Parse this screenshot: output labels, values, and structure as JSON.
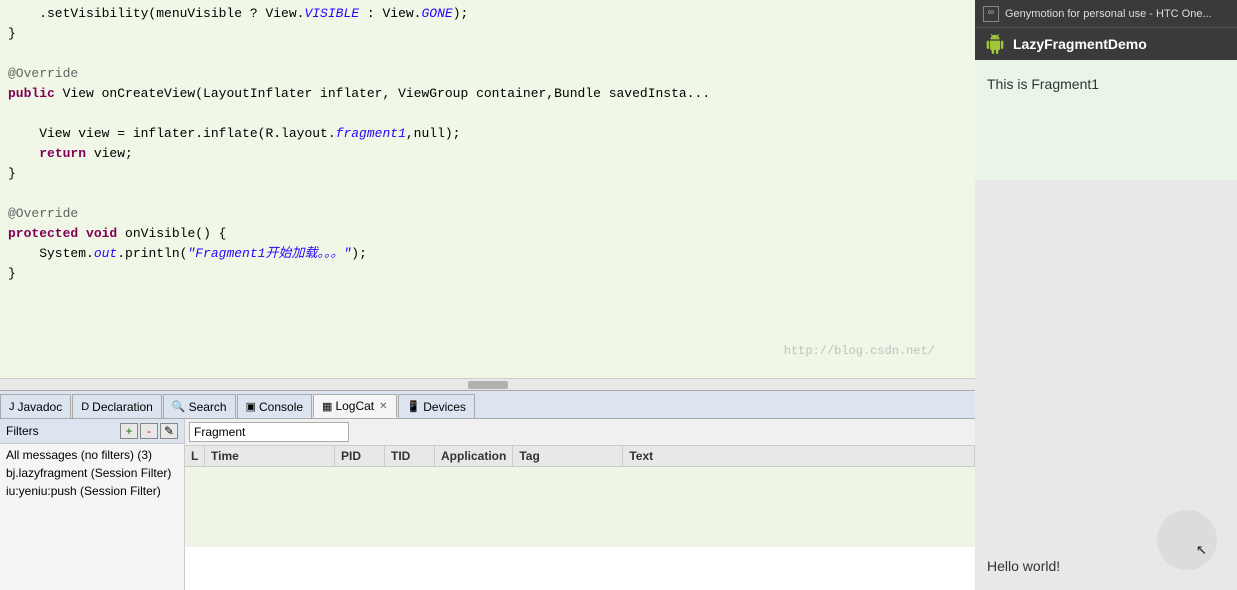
{
  "editor": {
    "code_lines": [
      {
        "content": "    .setVisibility(menuVisible ? View.",
        "italic": "VISIBLE",
        "rest": " : View.",
        "italic2": "GONE",
        "end": ");"
      },
      {
        "content": "}"
      },
      {
        "content": ""
      },
      {
        "content": "@Override",
        "type": "annotation"
      },
      {
        "content": "public View onCreateView(LayoutInflater inflater, ViewGroup container,Bundle savedInsta..."
      },
      {
        "content": ""
      },
      {
        "content": "    View view = inflater.inflate(R.layout.",
        "italic": "fragment1",
        "end": ",null);"
      },
      {
        "content": "    ",
        "kw": "return",
        "rest": " view;"
      },
      {
        "content": "}"
      },
      {
        "content": ""
      },
      {
        "content": "@Override",
        "type": "annotation"
      },
      {
        "content": "protected void onVisible() {"
      },
      {
        "content": "    System.",
        "italic_blue": "out",
        "rest": ".println(\"",
        "string": "Fragment1开始加载。。。",
        "end": "\");"
      },
      {
        "content": "}"
      }
    ],
    "watermark": "http://blog.csdn.net/"
  },
  "tabs": [
    {
      "id": "javadoc",
      "label": "Javadoc",
      "icon": "J",
      "active": false,
      "closable": false
    },
    {
      "id": "declaration",
      "label": "Declaration",
      "icon": "D",
      "active": false,
      "closable": false
    },
    {
      "id": "search",
      "label": "Search",
      "icon": "🔍",
      "active": false,
      "closable": false
    },
    {
      "id": "console",
      "label": "Console",
      "icon": "▣",
      "active": false,
      "closable": false
    },
    {
      "id": "logcat",
      "label": "LogCat",
      "icon": "▦",
      "active": true,
      "closable": true
    },
    {
      "id": "devices",
      "label": "Devices",
      "icon": "📱",
      "active": false,
      "closable": false
    }
  ],
  "filter_panel": {
    "title": "Filters",
    "add_btn": "+",
    "remove_btn": "-",
    "edit_btn": "✎",
    "items": [
      {
        "label": "All messages (no filters) (3)",
        "selected": false
      },
      {
        "label": "bj.lazyfragment (Session Filter)",
        "selected": false
      },
      {
        "label": "iu:yeniu:push (Session Filter)",
        "selected": false
      }
    ]
  },
  "logcat": {
    "filter_placeholder": "Fragment",
    "columns": [
      {
        "id": "l",
        "label": "L"
      },
      {
        "id": "time",
        "label": "Time"
      },
      {
        "id": "pid",
        "label": "PID"
      },
      {
        "id": "tid",
        "label": "TID"
      },
      {
        "id": "application",
        "label": "Application"
      },
      {
        "id": "tag",
        "label": "Tag"
      },
      {
        "id": "text",
        "label": "Text"
      }
    ]
  },
  "genymotion": {
    "title": "Genymotion for personal use - HTC One...",
    "logo": "∞",
    "app_title": "LazyFragmentDemo",
    "fragment1_text": "This is Fragment1",
    "hello_world_text": "Hello world!"
  }
}
